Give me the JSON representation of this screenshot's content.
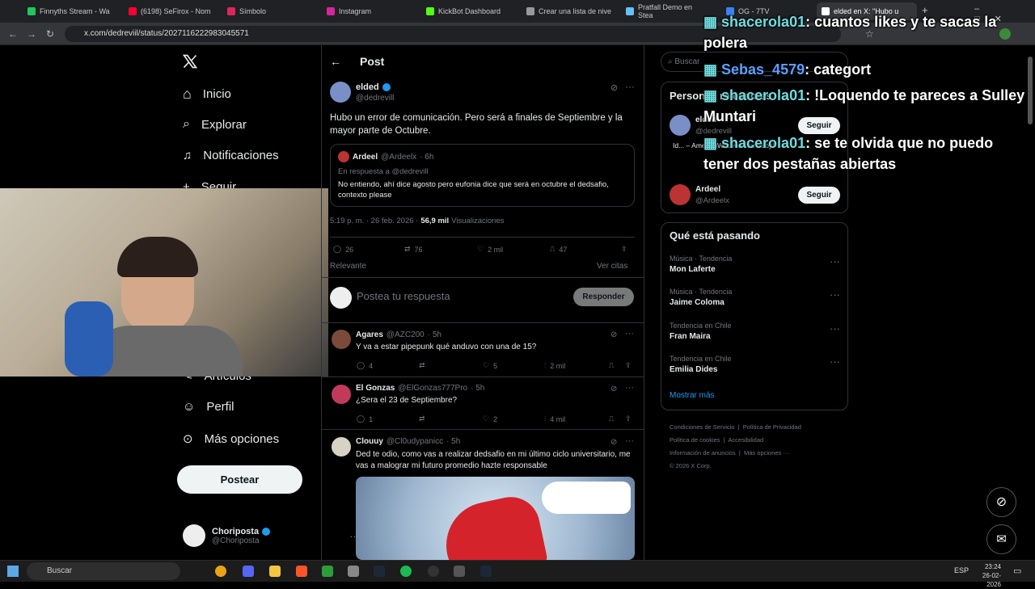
{
  "browser": {
    "tabs": [
      {
        "label": "Finnyths Stream - Wa",
        "color": "#22c55e"
      },
      {
        "label": "(6198) SeFirox - Nom",
        "color": "#ff0033"
      },
      {
        "label": "Símbolo",
        "color": "#e0245e"
      },
      {
        "label": "Instagram",
        "color": "#d6249f"
      },
      {
        "label": "KickBot Dashboard",
        "color": "#53fc18"
      },
      {
        "label": "Crear una lista de nive",
        "color": "#999999"
      },
      {
        "label": "Pratfall Demo en Stea",
        "color": "#1b2838"
      },
      {
        "label": "OG - 7TV",
        "color": "#3b82f6"
      },
      {
        "label": "elded en X: \"Hubo u",
        "color": "#ffffff"
      }
    ],
    "url": "x.com/dedreviil/status/2027116222983045571"
  },
  "sidebar": {
    "items": [
      {
        "label": "Inicio"
      },
      {
        "label": "Explorar"
      },
      {
        "label": "Notificaciones"
      },
      {
        "label": "Seguir"
      },
      {
        "label": "Artículos"
      },
      {
        "label": "Perfil"
      },
      {
        "label": "Más opciones"
      }
    ],
    "post_button": "Postear",
    "account": {
      "name": "Choriposta",
      "handle": "@Choriposta"
    }
  },
  "post": {
    "header": "Post",
    "author": {
      "name": "elded",
      "handle": "@dedrevill"
    },
    "text": "Hubo un error de comunicación. Pero será a finales de Septiembre y la mayor parte de Octubre.",
    "quote": {
      "name": "Ardeel",
      "handle": "@Ardeelx",
      "time": "· 6h",
      "reply_to": "En respuesta a @dedrevill",
      "text": "No entiendo, ahí dice agosto pero eufonia dice que será en octubre el dedsafio, contexto please"
    },
    "time": "5:19 p. m. · 26 feb. 2026 ·",
    "views_count": "56,9 mil",
    "views_label": "Visualizaciones",
    "stats": {
      "replies": "26",
      "reposts": "76",
      "likes": "2 mil",
      "bookmarks": "47"
    },
    "sort": "Relevante",
    "quotes_link": "Ver citas",
    "reply_placeholder": "Postea tu respuesta",
    "reply_button": "Responder"
  },
  "replies": [
    {
      "name": "Agares",
      "handle": "@AZC200",
      "time": "· 5h",
      "text": "Y va a estar pipepunk qué anduvo con una de 15?",
      "replies": "4",
      "reposts": "",
      "likes": "5",
      "views": "2 mil"
    },
    {
      "name": "El Gonzas",
      "handle": "@ElGonzas777Pro",
      "time": "· 5h",
      "text": "¿Sera el 23 de Septiembre?",
      "replies": "1",
      "reposts": "",
      "likes": "2",
      "views": "4 mil"
    },
    {
      "name": "Clouuy",
      "handle": "@Cl0udypanicc",
      "time": "· 5h",
      "text": "Ded te odio, como vas a realizar dedsafio en mi último ciclo universitario, me vas a malograr mi futuro promedio hazte responsable"
    }
  ],
  "right": {
    "search_placeholder": "Buscar",
    "people_title": "Personas relevantes",
    "people": [
      {
        "name": "elded",
        "handle": "@dedrevill",
        "bio": "Id... – Amelia We Love You Baby!",
        "follow": "Seguir"
      },
      {
        "name": "Ardeel",
        "handle": "@Ardeelx",
        "follow": "Seguir"
      }
    ],
    "trends_title": "Qué está pasando",
    "trends": [
      {
        "category": "Música · Tendencia",
        "name": "Mon Laferte"
      },
      {
        "category": "Música · Tendencia",
        "name": "Jaime Coloma"
      },
      {
        "category": "Tendencia en Chile",
        "name": "Fran Maira"
      },
      {
        "category": "Tendencia en Chile",
        "name": "Emilia Dides"
      }
    ],
    "show_more": "Mostrar más",
    "footer": [
      "Condiciones de Servicio",
      "Política de Privacidad",
      "Política de cookies",
      "Accesibilidad",
      "Información de anuncios",
      "Más opciones ···",
      "© 2026 X Corp."
    ]
  },
  "chat": [
    {
      "user": "shacerola01",
      "msg": ": cuantos likes y te sacas la polera"
    },
    {
      "user": "Sebas_4579",
      "msg": ": categort"
    },
    {
      "user": "shacerola01",
      "msg": ": !Loquendo te pareces a Sulley Muntari"
    },
    {
      "user": "shacerola01",
      "msg": ": se te olvida que no puedo tener dos pestañas abiertas"
    }
  ],
  "taskbar": {
    "search": "Buscar",
    "lang": "ESP",
    "time": "23:24",
    "date": "26-02-2026"
  },
  "colors": {
    "accent": "#1d9bf0",
    "verified": "#1d9bf0",
    "chat_user": "#6fdde0"
  }
}
